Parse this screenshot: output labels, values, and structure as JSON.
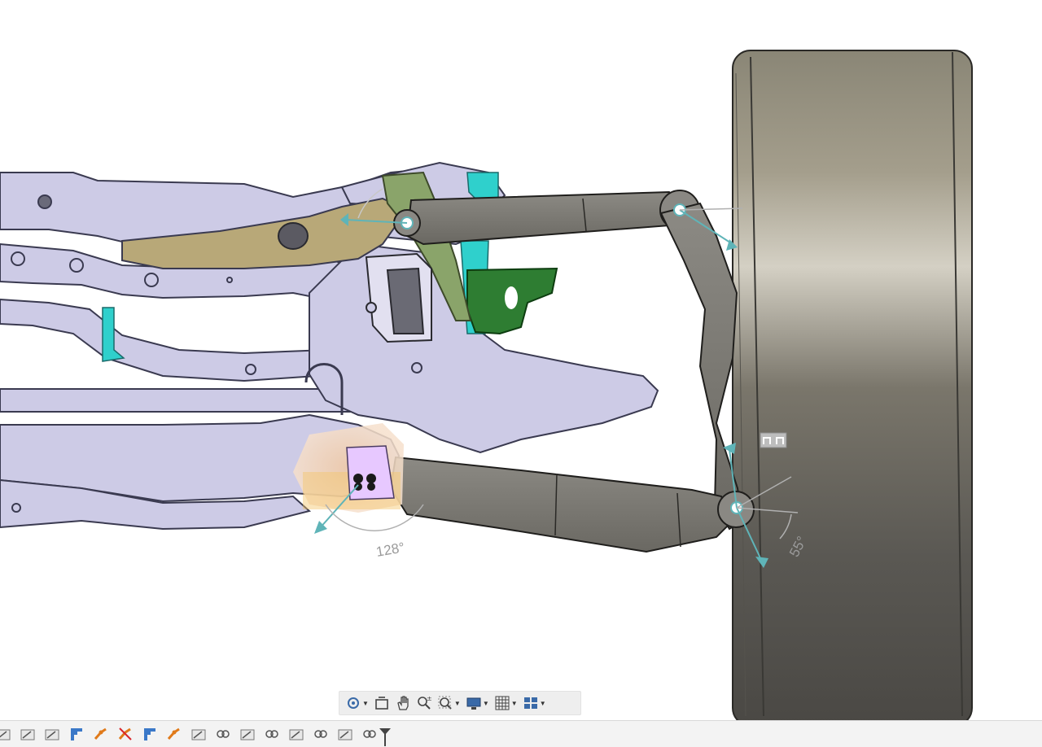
{
  "viewport": {
    "angle_labels": {
      "lower_arm_angle": "128°",
      "knuckle_angle": "55°"
    }
  },
  "nav_toolbar": {
    "tools": [
      {
        "name": "orbit-icon",
        "has_menu": true
      },
      {
        "name": "look-at-icon",
        "has_menu": false
      },
      {
        "name": "pan-icon",
        "has_menu": false
      },
      {
        "name": "zoom-icon",
        "has_menu": false
      },
      {
        "name": "fit-icon",
        "has_menu": true
      },
      {
        "name": "display-settings-icon",
        "has_menu": true
      },
      {
        "name": "grid-icon",
        "has_menu": true
      },
      {
        "name": "viewports-icon",
        "has_menu": true
      }
    ]
  },
  "timeline": {
    "items": [
      "sketch",
      "sketch",
      "sketch",
      "joint",
      "joint-orange",
      "joint-red",
      "joint",
      "joint-orange",
      "sketch",
      "joint-link",
      "sketch",
      "joint-link",
      "sketch",
      "joint-link",
      "sketch",
      "joint-link"
    ]
  },
  "colors": {
    "frame": "#cdcbe6",
    "frame_edge": "#3a3a50",
    "gold_plate": "#b8a878",
    "tire": "#7d7a6e",
    "arm": "#787670",
    "joint_highlight": "#5fb4b8",
    "cyan_part": "#2fd0cc",
    "green_part": "#2e7d32",
    "olive_part": "#8aa46a"
  }
}
